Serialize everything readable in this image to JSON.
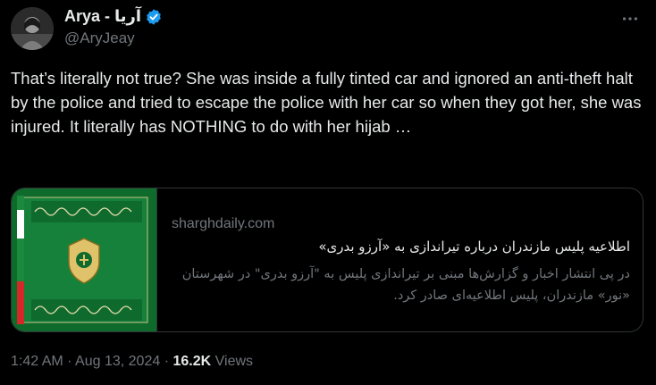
{
  "author": {
    "display_name": "Arya - آریا",
    "handle": "@AryJeay",
    "verified": true,
    "avatar_icon": "profile-photo"
  },
  "tweet": {
    "text": "That’s literally not true? She was inside a fully tinted car and ignored an anti-theft halt by the police and tried to escape the police with her car so when they got her, she was injured. It literally has NOTHING to do with her hijab …"
  },
  "card": {
    "domain": "sharghdaily.com",
    "title": "اطلاعیه پلیس مازندران درباره تیراندازی به «آرزو بدری»",
    "description": "در پی انتشار اخبار و گزارش‌ها مبنی بر تیراندازی پلیس به \"آرزو بدری\" در شهرستان «نور» مازندران، پلیس اطلاعیه‌ای صادر کرد.",
    "thumbnail_icon": "police-flag-image"
  },
  "meta": {
    "time": "1:42 AM",
    "separator": "·",
    "date": "Aug 13, 2024",
    "views_count": "16.2K",
    "views_label": "Views"
  },
  "colors": {
    "background": "#000000",
    "text_primary": "#e7e9ea",
    "text_secondary": "#71767b",
    "verified_blue": "#1d9bf0",
    "border": "#2f3336"
  }
}
